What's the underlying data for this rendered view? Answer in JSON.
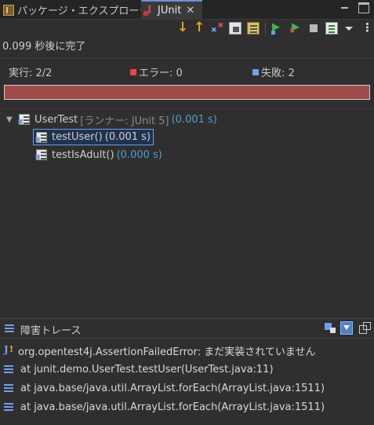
{
  "tabs": [
    {
      "label": "パッケージ・エクスプローラー",
      "icon": "package-explorer-icon"
    },
    {
      "label": "JUnit",
      "icon": "junit-icon",
      "active": true
    }
  ],
  "status": "0.099 秒後に完了",
  "counters": {
    "runs": "実行:  2/2",
    "errors": "エラー:  0",
    "failures": "失敗:  2"
  },
  "progress": {
    "fraction": 1.0,
    "color": "#a14b4b"
  },
  "tree": {
    "suite": {
      "name": "UserTest",
      "runner": "[ランナー: JUnit 5]",
      "time": "(0.001 s)"
    },
    "tests": [
      {
        "name": "testUser()",
        "time": "(0.001 s)",
        "selected": true
      },
      {
        "name": "testIsAdult()",
        "time": "(0.000 s)",
        "selected": false
      }
    ]
  },
  "trace": {
    "title": "障害トレース",
    "lines": [
      "org.opentest4j.AssertionFailedError: まだ実装されていません",
      "at junit.demo.UserTest.testUser(UserTest.java:11)",
      "at java.base/java.util.ArrayList.forEach(ArrayList.java:1511)",
      "at java.base/java.util.ArrayList.forEach(ArrayList.java:1511)"
    ]
  }
}
